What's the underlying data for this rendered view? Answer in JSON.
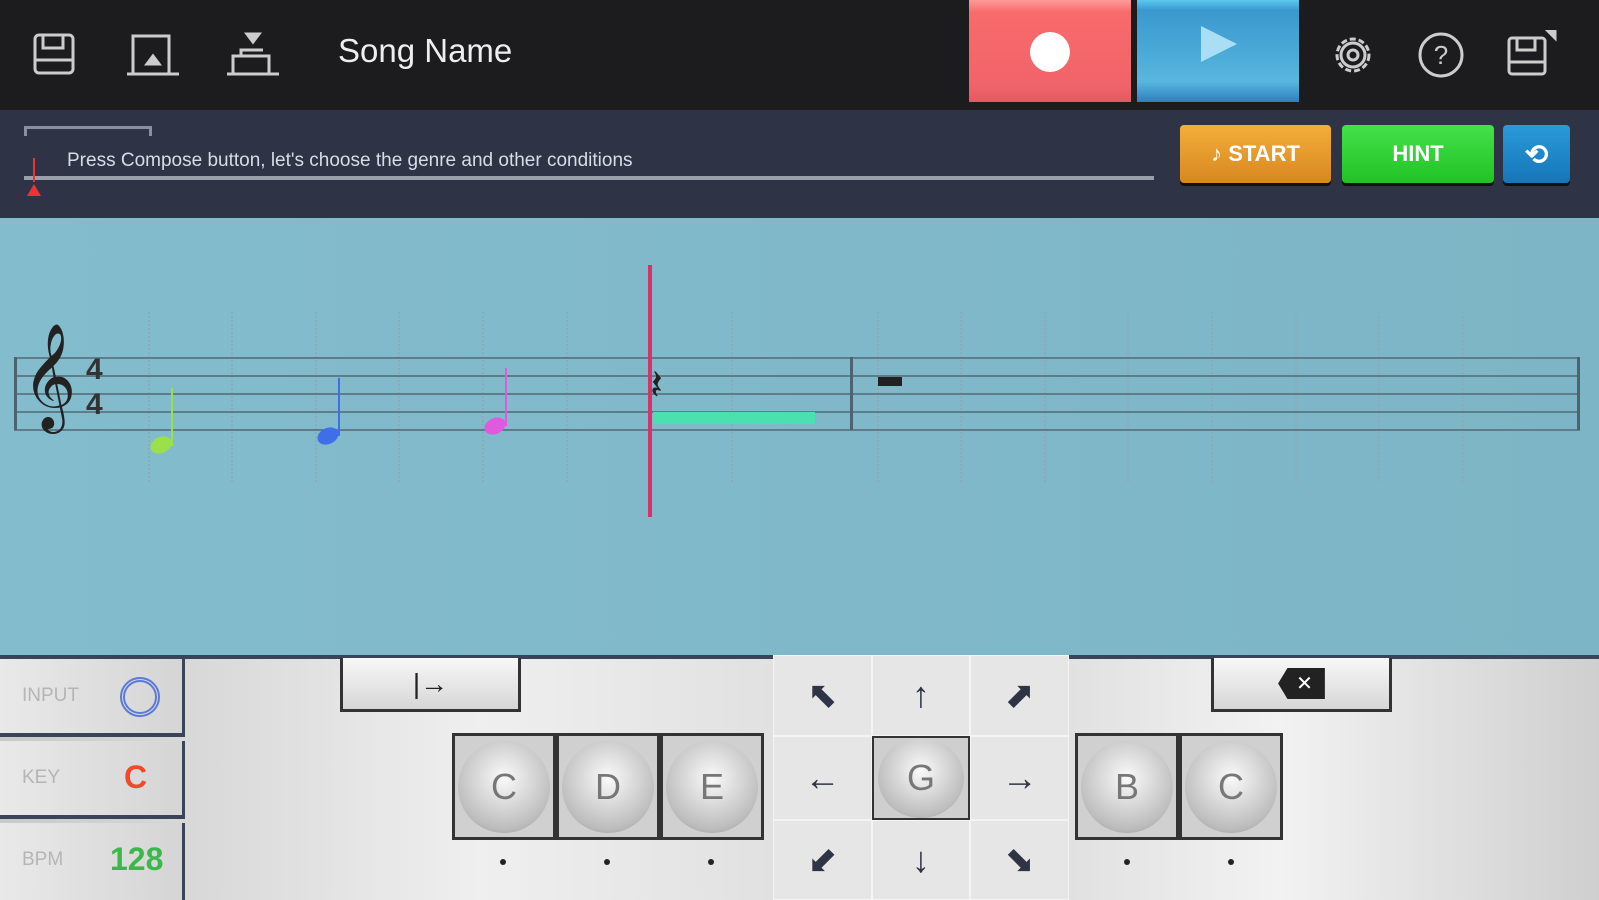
{
  "header": {
    "title": "Song Name",
    "icons": [
      "save-icon",
      "load-icon",
      "import-icon",
      "settings-icon",
      "help-icon",
      "save-as-icon"
    ]
  },
  "hintbar": {
    "message": "Press Compose button, let's choose the genre and other conditions",
    "start_label": "♪ START",
    "hint_label": "HINT",
    "refresh_symbol": "⟲"
  },
  "colors": {
    "record": "#f0636a",
    "play": "#3a98cf",
    "start": "#e0962a",
    "hint": "#2ad02f",
    "score_bg": "#80b8c9",
    "cursor": "#d6336c"
  },
  "score": {
    "clef": "𝄞",
    "time_sig_top": "4",
    "time_sig_bottom": "4",
    "rest": "𝄽"
  },
  "controls": {
    "input_label": "INPUT",
    "key_label": "KEY",
    "key_value": "C",
    "bpm_label": "BPM",
    "bpm_value": "128",
    "tab_symbol": "|→",
    "backspace_symbol": "✕",
    "left_keys": [
      "C",
      "D",
      "E"
    ],
    "center_key": "G",
    "right_keys": [
      "B",
      "C"
    ],
    "arrows": [
      "⬉",
      "↑",
      "⬈",
      "←",
      "G",
      "→",
      "⬋",
      "↓",
      "⬊"
    ]
  }
}
